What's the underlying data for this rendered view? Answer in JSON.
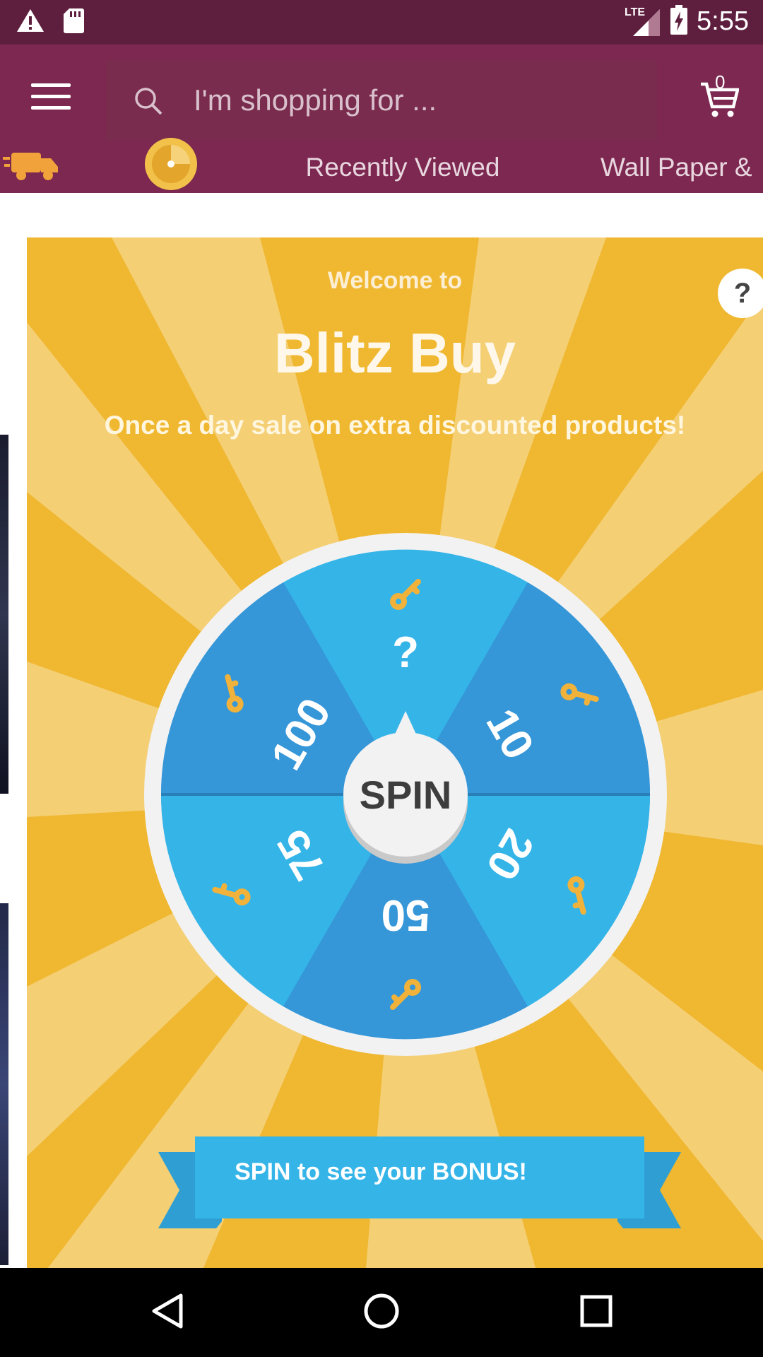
{
  "status_bar": {
    "time": "5:55",
    "network": "LTE",
    "icons": [
      "warning-icon",
      "sd-card-icon",
      "signal-icon",
      "battery-charging-icon"
    ]
  },
  "app_bar": {
    "search_placeholder": "I'm shopping for ...",
    "cart_count": "0"
  },
  "tabs": [
    {
      "label": "",
      "icon": "delivery-truck-icon"
    },
    {
      "label": "",
      "icon": "spin-coin-icon",
      "selected": true
    },
    {
      "label": "Recently Viewed"
    },
    {
      "label": "Wall Paper &"
    }
  ],
  "game": {
    "welcome": "Welcome to",
    "title": "Blitz Buy",
    "subtitle": "Once a day sale on extra discounted products!",
    "help_label": "?",
    "spin_label": "SPIN",
    "wheel_segments": [
      "?",
      "10",
      "20",
      "50",
      "75",
      "100"
    ],
    "banner_text": "SPIN to see your BONUS!",
    "colors": {
      "background": "#f0b730",
      "ray_light": "#f5d27c",
      "wheel_dark": "#3596d8",
      "wheel_light": "#35b4e8",
      "key": "#f0b23a",
      "banner": "#35b4e8"
    }
  },
  "nav_bar": {
    "icons": [
      "back-icon",
      "home-icon",
      "recents-icon"
    ]
  },
  "theme": {
    "status_bar": "#5e1f3e",
    "app_bar": "#7d2850"
  }
}
